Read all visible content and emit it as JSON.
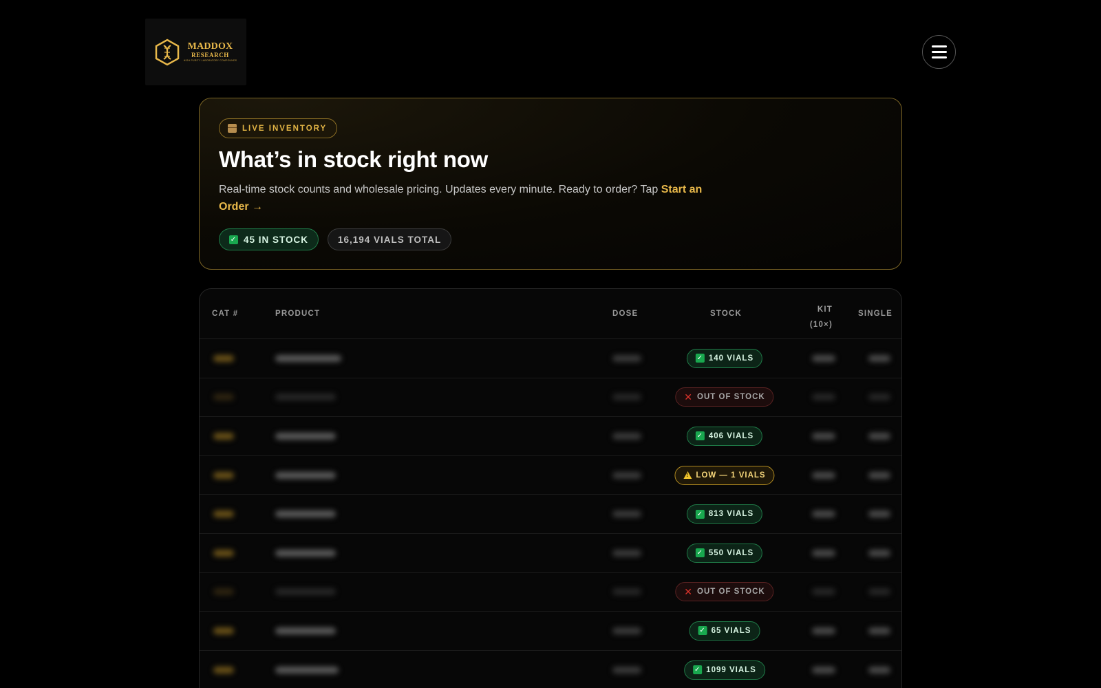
{
  "logo": {
    "title": "MADDOX",
    "subtitle": "RESEARCH",
    "tagline": "HIGH PURITY LABORATORY COMPOUNDS"
  },
  "hero": {
    "pill_label": "LIVE INVENTORY",
    "title": "What’s in stock right now",
    "description": "Real-time stock counts and wholesale pricing. Updates every minute. Ready to order? Tap ",
    "cta": "Start an Order →",
    "in_stock_label": "45 IN STOCK",
    "total_label": "16,194 VIALS TOTAL"
  },
  "table": {
    "headers": {
      "cat": "CAT #",
      "product": "PRODUCT",
      "dose": "DOSE",
      "stock": "STOCK",
      "kit": "KIT (10×)",
      "single": "SINGLE"
    },
    "rows": [
      {
        "status": "in",
        "stock_label": "140 VIALS"
      },
      {
        "status": "out",
        "stock_label": "OUT OF STOCK"
      },
      {
        "status": "in",
        "stock_label": "406 VIALS"
      },
      {
        "status": "low",
        "stock_label": "LOW — 1 VIALS"
      },
      {
        "status": "in",
        "stock_label": "813 VIALS"
      },
      {
        "status": "in",
        "stock_label": "550 VIALS"
      },
      {
        "status": "out",
        "stock_label": "OUT OF STOCK"
      },
      {
        "status": "in",
        "stock_label": "65 VIALS"
      },
      {
        "status": "in",
        "stock_label": "1099 VIALS"
      }
    ]
  },
  "colors": {
    "accent_gold": "#e8b84a",
    "in_stock_green": "#1f7a47",
    "out_red": "#e0342c",
    "low_yellow": "#f0c42c"
  }
}
